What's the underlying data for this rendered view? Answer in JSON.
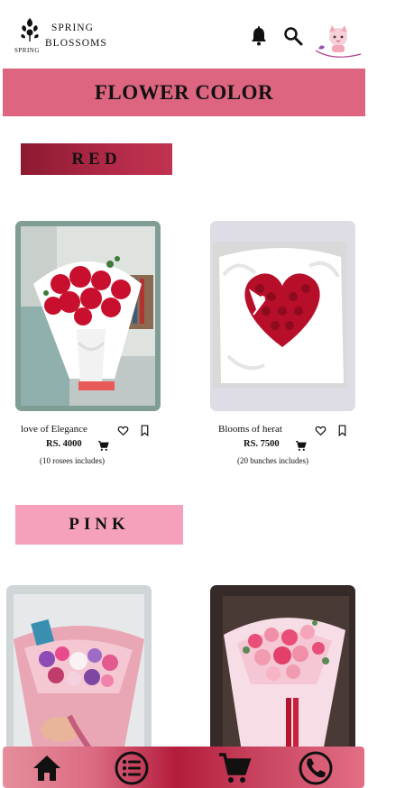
{
  "brand": {
    "line1": "SPRING",
    "line2": "BLOSSOMS",
    "mark_text": "SPRING",
    "tagline": "BLOSSOMS"
  },
  "header": {
    "icons": [
      "bell-icon",
      "search-icon",
      "mascot-avatar"
    ]
  },
  "banner": {
    "title": "FLOWER COLOR"
  },
  "sections": [
    {
      "title": "RED",
      "products": [
        {
          "name": "love of Elegance",
          "price": "RS. 4000",
          "note": "(10 rosees includes)"
        },
        {
          "name": "Blooms of herat",
          "price": "RS. 7500",
          "note": "(20 bunches includes)"
        }
      ]
    },
    {
      "title": "PINK",
      "products": []
    }
  ],
  "bottom_nav": {
    "items": [
      "home-icon",
      "list-icon",
      "cart-icon",
      "phone-icon"
    ]
  },
  "colors": {
    "banner": "#dd6580",
    "red_section": "#a2213d",
    "pink_section": "#f6a1bb",
    "nav_gradient_mid": "#b31c3c"
  }
}
